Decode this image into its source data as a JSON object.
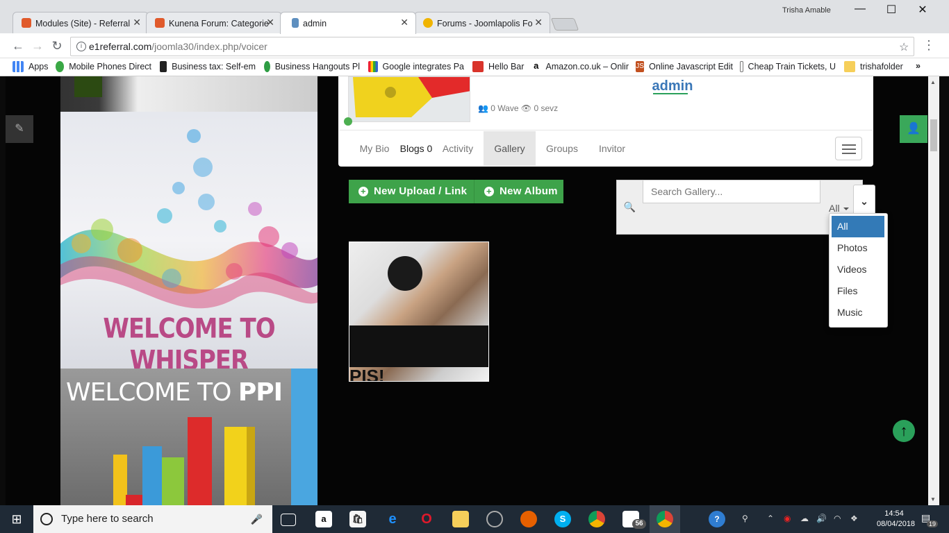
{
  "browser": {
    "tabs": [
      {
        "title": "Modules (Site) - Referral",
        "active": false
      },
      {
        "title": "Kunena Forum: Categorie",
        "active": false
      },
      {
        "title": "admin",
        "active": true
      },
      {
        "title": "Forums - Joomlapolis Fo",
        "active": false
      }
    ],
    "window_user": "Trisha Amable",
    "address": {
      "host": "e1referral.com",
      "path": "/joomla30/index.php/voicer"
    },
    "bookmarks": [
      "Apps",
      "Mobile Phones Direct",
      "Business tax: Self-em",
      "Business Hangouts Pl",
      "Google integrates Pa",
      "Hello Bar",
      "Amazon.co.uk – Onlir",
      "Online Javascript Edit",
      "Cheap Train Tickets, U",
      "trishafolder"
    ],
    "more_bookmarks": "»"
  },
  "banners": {
    "whisper_text": "WELCOME TO WHISPER",
    "ppi_text_a": "WELCOME TO ",
    "ppi_text_b": "PPI"
  },
  "profile": {
    "name": "admin",
    "waves": "0 Wave",
    "views": "0 sevz",
    "tabs": [
      {
        "label": "My Bio",
        "active": false
      },
      {
        "label": "Blogs 0",
        "active": false
      },
      {
        "label": "Activity",
        "active": false
      },
      {
        "label": "Gallery",
        "active": true
      },
      {
        "label": "Groups",
        "active": false
      },
      {
        "label": "Invitor",
        "active": false
      }
    ]
  },
  "gallery": {
    "new_upload_label": "New Upload / Link",
    "new_album_label": "New Album",
    "search_placeholder": "Search Gallery...",
    "filter_value": "All",
    "filter_options": [
      "All",
      "Photos",
      "Videos",
      "Files",
      "Music"
    ],
    "photo_caption": "PIS!"
  },
  "taskbar": {
    "search_placeholder": "Type here to search",
    "time": "14:54",
    "date": "08/04/2018",
    "mail_badge": "56",
    "notification_count": "19"
  },
  "colors": {
    "accent_green": "#3ea34a",
    "link_blue": "#3a77b8",
    "selected_blue": "#337ab7"
  }
}
